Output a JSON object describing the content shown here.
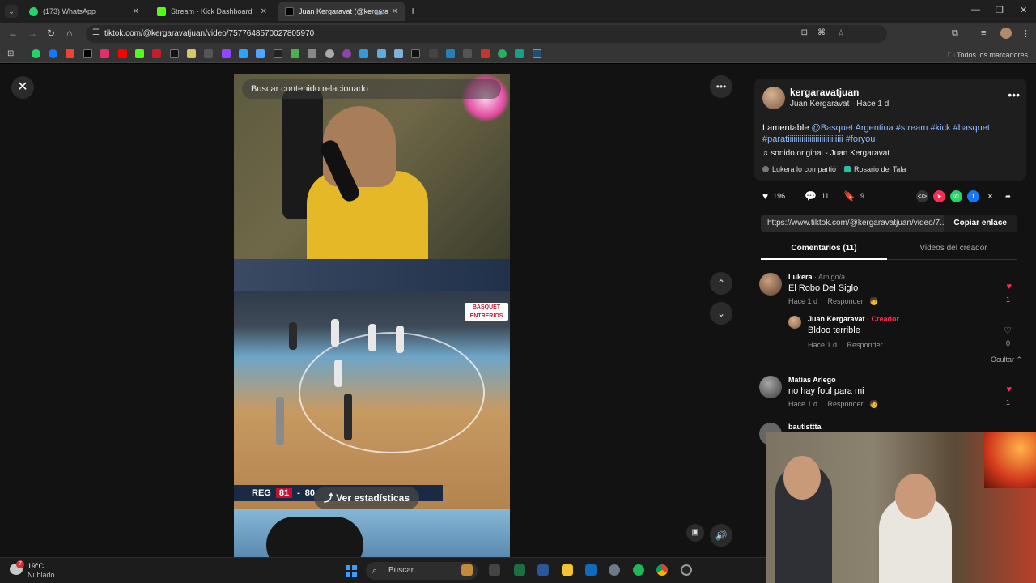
{
  "browser": {
    "tabs": [
      {
        "title": "(173) WhatsApp",
        "icon": "whatsapp-icon",
        "color": "#25D366"
      },
      {
        "title": "Stream - Kick Dashboard",
        "icon": "kick-icon",
        "color": "#53FC18"
      },
      {
        "title": "Juan Kergaravat (@kergara",
        "icon": "tiktok-icon",
        "color": "#ffffff"
      }
    ],
    "url": "tiktok.com/@kergaravatjuan/video/7577648570027805970",
    "bookmarks_all_label": "Todos los marcadores"
  },
  "video": {
    "search_placeholder": "Buscar contenido relacionado",
    "stats_label": "Ver estadísticas",
    "score_team": "REG",
    "score_home": "81",
    "score_sep": "-",
    "score_away": "80",
    "logo_text_1": "BASQUET",
    "logo_text_2": "ENTRERIOS"
  },
  "post": {
    "username": "kergaravatjuan",
    "display_name": "Juan Kergaravat",
    "time": "Hace 1 d",
    "sub_sep": " · ",
    "caption_word": "Lamentable ",
    "caption_tags": [
      "@Basquet Argentina",
      "#stream",
      "#kick",
      "#basquet",
      "#paratiiiiiiiiiiiiiiiiiiiiiiiiiiii",
      "#foryou"
    ],
    "sound": "sonido original - Juan Kergaravat",
    "shared_by": "Lukera lo compartió",
    "shared_with": "Rosario del Tala",
    "likes": "196",
    "comments_count": "11",
    "saves": "9",
    "link": "https://www.tiktok.com/@kergaravatjuan/video/7...",
    "copy_label": "Copiar enlace",
    "tab_comments": "Comentarios (11)",
    "tab_creator_videos": "Videos del creador"
  },
  "comments": [
    {
      "name": "Lukera",
      "role": " · Amigo/a",
      "text": "El Robo Del Siglo",
      "time": "Hace 1 d",
      "reply": "Responder",
      "likes": "1",
      "liked": true
    },
    {
      "name": "Juan Kergaravat",
      "role": " · Creador",
      "text": "Bldoo terrible",
      "time": "Hace 1 d",
      "reply": "Responder",
      "likes": "0",
      "liked": false
    },
    {
      "name": "Matias Arlego",
      "role": "",
      "text": "no hay foul para mi",
      "time": "Hace 1 d",
      "reply": "Responder",
      "likes": "1",
      "liked": true
    },
    {
      "name": "bautisttta",
      "role": "",
      "text": "",
      "time": "",
      "reply": "",
      "likes": "",
      "liked": false
    }
  ],
  "hide_label": "Ocultar",
  "taskbar": {
    "temperature": "19°C",
    "weather": "Nublado",
    "notification_count": "7",
    "search_label": "Buscar"
  },
  "colors": {
    "accent_red": "#FE2C55",
    "link_blue": "#8EBCFF"
  }
}
